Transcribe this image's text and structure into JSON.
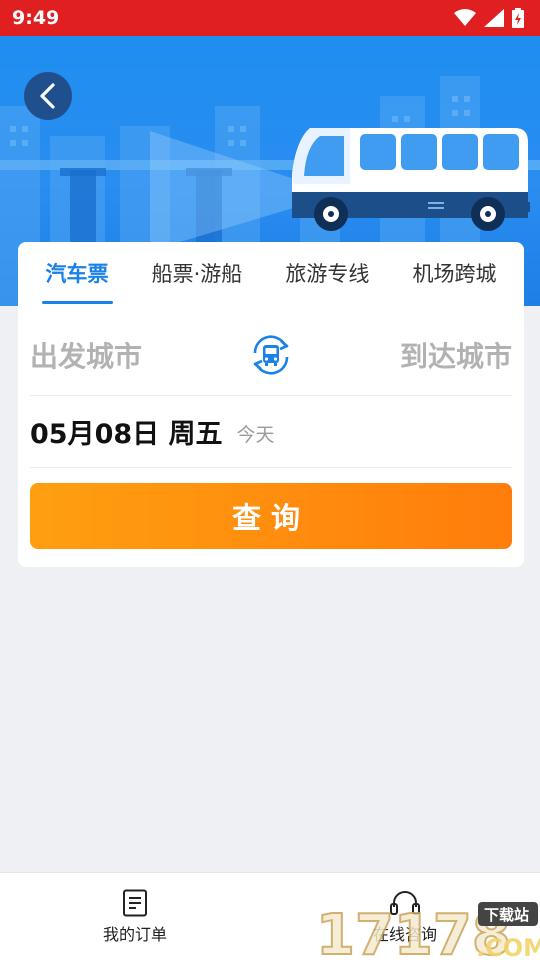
{
  "status_bar": {
    "time": "9:49"
  },
  "tabs": [
    {
      "label": "汽车票",
      "active": true
    },
    {
      "label": "船票·游船",
      "active": false
    },
    {
      "label": "旅游专线",
      "active": false
    },
    {
      "label": "机场跨城",
      "active": false
    }
  ],
  "search": {
    "from_city": "出发城市",
    "to_city": "到达城市",
    "date": "05月08日 周五",
    "date_hint": "今天",
    "query_label": "查询"
  },
  "bottom_nav": [
    {
      "label": "我的订单",
      "icon": "document-icon"
    },
    {
      "label": "在线咨询",
      "icon": "headset-icon"
    }
  ],
  "watermark": {
    "brand": "17178",
    "sub": ".COM",
    "badge": "下载站"
  },
  "colors": {
    "status_bar": "#e02020",
    "accent": "#1a82e6",
    "query_button": "#ff8a0e",
    "hero": "#2a8df0"
  }
}
